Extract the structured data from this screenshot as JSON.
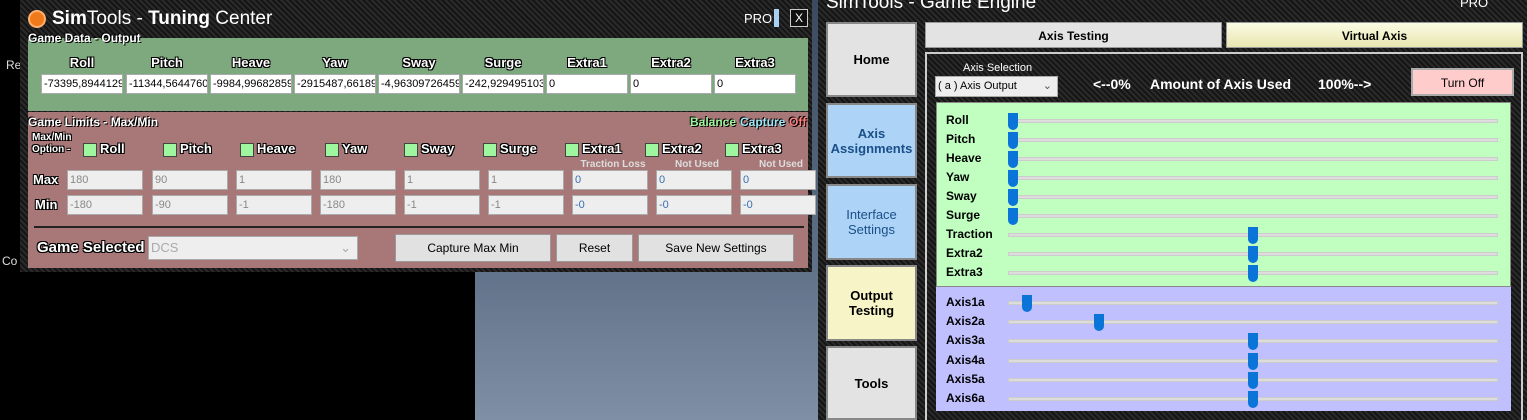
{
  "background": {
    "left_text": [
      "Re",
      "Co"
    ]
  },
  "tuning": {
    "title_bold1": "Sim",
    "title_1": "Tools - ",
    "title_bold2": "Tuning",
    "title_2": " Center",
    "pro": "PRO",
    "close": "X",
    "game_data_title": "Game Data - Output",
    "columns": [
      "Roll",
      "Pitch",
      "Heave",
      "Yaw",
      "Sway",
      "Surge",
      "Extra1",
      "Extra2",
      "Extra3"
    ],
    "outputs": [
      "-73395,8944129",
      "-11344,5644760",
      "-9984,99682859",
      "-2915487,66189",
      "-4,96309726459",
      "-242,929495103",
      "0",
      "0",
      "0"
    ],
    "limits_title": "Game Limits - Max/Min",
    "balance": "Balance",
    "capture": "Capture",
    "off": "Off",
    "option_label": "Max/Min Option -",
    "sublabels": [
      "",
      "",
      "",
      "",
      "",
      "",
      "Traction Loss",
      "Not Used",
      "Not Used"
    ],
    "max_label": "Max",
    "min_label": "Min",
    "max": [
      "180",
      "90",
      "1",
      "180",
      "1",
      "1",
      "0",
      "0",
      "0"
    ],
    "min": [
      "-180",
      "-90",
      "-1",
      "-180",
      "-1",
      "-1",
      "-0",
      "-0",
      "-0"
    ],
    "game_selected_label": "Game Selected",
    "game_selected": "DCS",
    "capture_btn": "Capture Max Min",
    "reset_btn": "Reset",
    "save_btn": "Save New Settings"
  },
  "engine": {
    "title": "SimTools - Game Engine",
    "pro": "PRO",
    "sidebar": [
      "Home",
      "Axis Assignments",
      "Interface Settings",
      "Output Testing",
      "Tools"
    ],
    "tabs": [
      "Axis Testing",
      "Virtual Axis"
    ],
    "axis_selection_label": "Axis Selection",
    "axis_selection": "( a ) Axis Output",
    "range_left": "<--0%",
    "range_mid": "Amount of Axis Used",
    "range_right": "100%-->",
    "turn_off": "Turn Off",
    "dof_sliders": [
      {
        "label": "Roll",
        "value": 0
      },
      {
        "label": "Pitch",
        "value": 0
      },
      {
        "label": "Heave",
        "value": 0
      },
      {
        "label": "Yaw",
        "value": 0
      },
      {
        "label": "Sway",
        "value": 0
      },
      {
        "label": "Surge",
        "value": 0
      },
      {
        "label": "Traction",
        "value": 50
      },
      {
        "label": "Extra2",
        "value": 50
      },
      {
        "label": "Extra3",
        "value": 50
      }
    ],
    "axis_sliders": [
      {
        "label": "Axis1a",
        "value": 3
      },
      {
        "label": "Axis2a",
        "value": 18
      },
      {
        "label": "Axis3a",
        "value": 50
      },
      {
        "label": "Axis4a",
        "value": 50
      },
      {
        "label": "Axis5a",
        "value": 50
      },
      {
        "label": "Axis6a",
        "value": 50
      }
    ]
  },
  "colors": {
    "green_panel": "#7ea87e",
    "pink_panel": "#a87878",
    "slider_thumb": "#0a74d8",
    "dof_bg": "#c0ffc0",
    "axis_bg": "#c0c0ff"
  }
}
